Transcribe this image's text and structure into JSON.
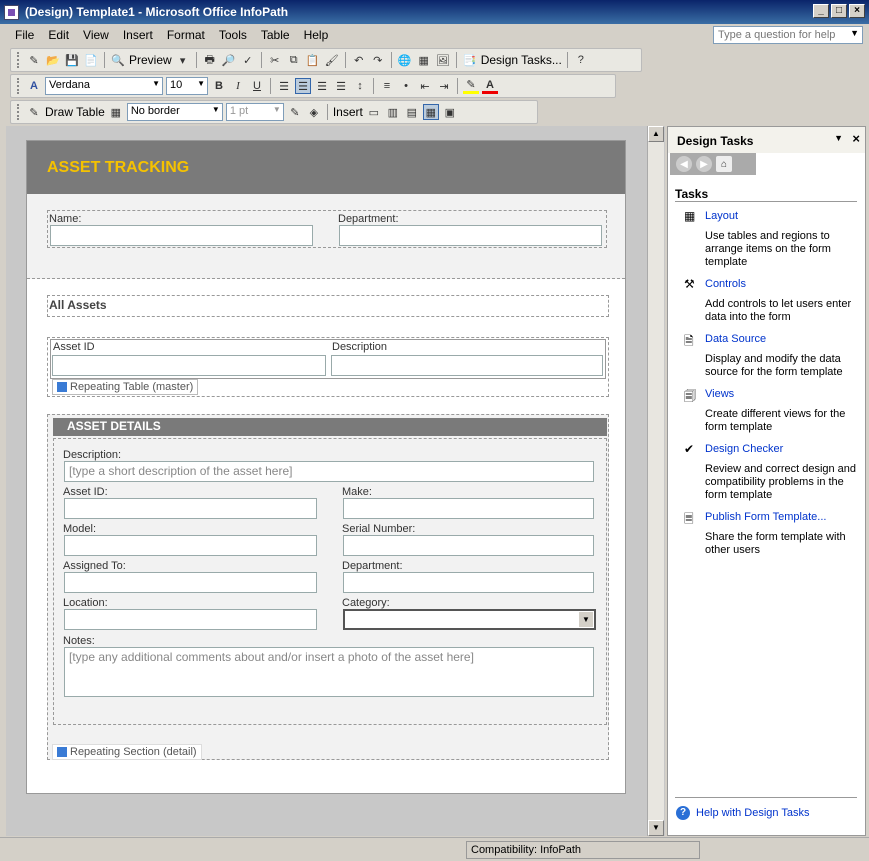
{
  "window": {
    "title": "(Design) Template1 - Microsoft Office InfoPath"
  },
  "menu": [
    "File",
    "Edit",
    "View",
    "Insert",
    "Format",
    "Tools",
    "Table",
    "Help"
  ],
  "ask": {
    "placeholder": "Type a question for help"
  },
  "toolbar": {
    "preview": "Preview",
    "design_tasks": "Design Tasks...",
    "font": "Verdana",
    "size": "10",
    "draw_table": "Draw Table",
    "border": "No border",
    "pt": "1 pt",
    "insert": "Insert"
  },
  "form": {
    "title": "ASSET TRACKING",
    "name_label": "Name:",
    "department_label": "Department:",
    "all_assets": "All Assets",
    "columns": [
      "Asset ID",
      "Description"
    ],
    "repeating_table": "Repeating Table (master)",
    "details_title": "ASSET DETAILS",
    "description_label": "Description:",
    "description_ph": "[type a short description of the asset here]",
    "asset_id_label": "Asset ID:",
    "make_label": "Make:",
    "model_label": "Model:",
    "serial_label": "Serial Number:",
    "assigned_label": "Assigned To:",
    "dept_label": "Department:",
    "location_label": "Location:",
    "category_label": "Category:",
    "notes_label": "Notes:",
    "notes_ph": "[type any additional comments about and/or insert a photo of the asset here]",
    "repeating_section": "Repeating Section (detail)"
  },
  "pane": {
    "title": "Design Tasks",
    "tasks_heading": "Tasks",
    "items": [
      {
        "label": "Layout",
        "desc": "Use tables and regions to arrange items on the form template"
      },
      {
        "label": "Controls",
        "desc": "Add controls to let users enter data into the form"
      },
      {
        "label": "Data Source",
        "desc": "Display and modify the data source for the form template"
      },
      {
        "label": "Views",
        "desc": "Create different views for the form template"
      },
      {
        "label": "Design Checker",
        "desc": "Review and correct design and compatibility problems in the form template"
      },
      {
        "label": "Publish Form Template...",
        "desc": "Share the form template with other users"
      }
    ],
    "help": "Help with Design Tasks"
  },
  "status": {
    "compat": "Compatibility: InfoPath"
  }
}
